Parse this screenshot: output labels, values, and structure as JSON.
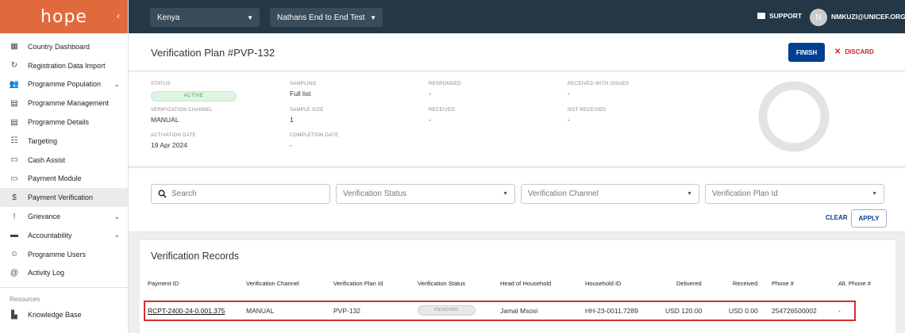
{
  "logo": "hope",
  "sidebar": {
    "items": [
      {
        "label": "Country Dashboard",
        "icon": "dashboard-icon",
        "glyph": "▦"
      },
      {
        "label": "Registration Data Import",
        "icon": "import-icon",
        "glyph": "↻"
      },
      {
        "label": "Programme Population",
        "icon": "people-icon",
        "glyph": "👥",
        "expandable": true
      },
      {
        "label": "Programme Management",
        "icon": "document-icon",
        "glyph": "▤"
      },
      {
        "label": "Programme Details",
        "icon": "document-icon",
        "glyph": "▤"
      },
      {
        "label": "Targeting",
        "icon": "target-list-icon",
        "glyph": "☷"
      },
      {
        "label": "Cash Assist",
        "icon": "card-icon",
        "glyph": "▭"
      },
      {
        "label": "Payment Module",
        "icon": "card-icon",
        "glyph": "▭"
      },
      {
        "label": "Payment Verification",
        "icon": "dollar-icon",
        "glyph": "$",
        "active": true
      },
      {
        "label": "Grievance",
        "icon": "alert-icon",
        "glyph": "!",
        "expandable": true
      },
      {
        "label": "Accountability",
        "icon": "chat-icon",
        "glyph": "▬",
        "expandable": true
      },
      {
        "label": "Programme Users",
        "icon": "users-icon",
        "glyph": "☺"
      },
      {
        "label": "Activity Log",
        "icon": "at-icon",
        "glyph": "@"
      }
    ],
    "resources_heading": "Resources",
    "resources": [
      {
        "label": "Knowledge Base",
        "icon": "book-icon",
        "glyph": "▙"
      }
    ]
  },
  "topbar": {
    "country": "Kenya",
    "programme": "Nathans End to End Test",
    "support": "SUPPORT",
    "avatar_initial": "N",
    "user": "NMKUZI@UNICEF.ORG"
  },
  "header": {
    "title": "Verification Plan #PVP-132",
    "finish": "FINISH",
    "discard": "DISCARD"
  },
  "details": {
    "status_label": "STATUS",
    "status": "ACTIVE",
    "channel_label": "VERIFICATION CHANNEL",
    "channel": "MANUAL",
    "activation_label": "ACTIVATION DATE",
    "activation": "19 Apr 2024",
    "sampling_label": "SAMPLING",
    "sampling": "Full list",
    "sample_size_label": "SAMPLE SIZE",
    "sample_size": "1",
    "completion_label": "COMPLETION DATE",
    "completion": "-",
    "responded_label": "RESPONDED",
    "responded": "-",
    "received_label": "RECEIVED",
    "received": "-",
    "issues_label": "RECEIVED WITH ISSUES",
    "issues": "-",
    "not_received_label": "NOT RECEIVED",
    "not_received": "-"
  },
  "filters": {
    "search_placeholder": "Search",
    "status_placeholder": "Verification Status",
    "channel_placeholder": "Verification Channel",
    "plan_placeholder": "Verification Plan Id",
    "clear": "CLEAR",
    "apply": "APPLY"
  },
  "records": {
    "title": "Verification Records",
    "columns": [
      "Payment ID",
      "Verification Channel",
      "Verification Plan Id",
      "Verification Status",
      "Head of Household",
      "Household ID",
      "Delivered",
      "Received",
      "Phone #",
      "Alt. Phone #"
    ],
    "row": {
      "payment_id": "RCPT-2400-24-0.001.375",
      "channel": "MANUAL",
      "plan_id": "PVP-132",
      "status": "PENDING",
      "head": "Jamal Msosi",
      "household_id": "HH-23-0011.7289",
      "delivered": "USD 120.00",
      "received": "USD 0.00",
      "phone": "254726500002",
      "alt_phone": "-"
    }
  },
  "colors": {
    "brand": "#e06a3b",
    "topbar": "#243746",
    "primary": "#033f91",
    "discard": "#c62828",
    "active_badge": "#43a047",
    "highlight": "#d32f2f"
  }
}
